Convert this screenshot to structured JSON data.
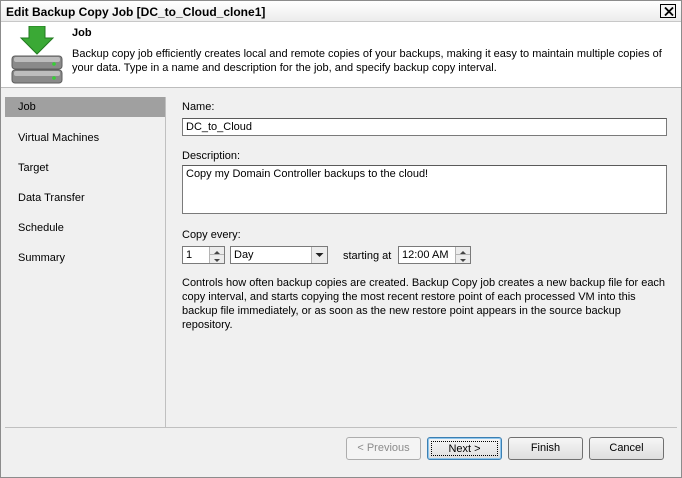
{
  "window": {
    "title": "Edit Backup Copy Job [DC_to_Cloud_clone1]",
    "close_icon": "close-icon"
  },
  "header": {
    "title": "Job",
    "description": "Backup copy job efficiently creates local and remote copies of your backups, making it easy to maintain multiple copies of your data. Type in a name and description for the job, and specify backup copy interval.",
    "logo_icon": "backup-copy-icon"
  },
  "sidebar": {
    "items": [
      {
        "label": "Job",
        "active": true
      },
      {
        "label": "Virtual Machines",
        "active": false
      },
      {
        "label": "Target",
        "active": false
      },
      {
        "label": "Data Transfer",
        "active": false
      },
      {
        "label": "Schedule",
        "active": false
      },
      {
        "label": "Summary",
        "active": false
      }
    ]
  },
  "form": {
    "name_label": "Name:",
    "name_value": "DC_to_Cloud",
    "description_label": "Description:",
    "description_value": "Copy my Domain Controller backups to the cloud!",
    "copy_every_label": "Copy every:",
    "interval_value": "1",
    "interval_unit": "Day",
    "starting_at_label": "starting at",
    "start_time": "12:00 AM",
    "help_text": "Controls how often backup copies are created. Backup Copy job creates a new backup file for each copy interval, and starts copying the most recent restore point of each processed VM into this backup file immediately, or as soon as the new restore point appears in the source backup repository."
  },
  "buttons": {
    "previous": "< Previous",
    "next": "Next >",
    "finish": "Finish",
    "cancel": "Cancel"
  },
  "colors": {
    "sidebar_active": "#a0a0a0",
    "arrow_green": "#3aa935"
  }
}
